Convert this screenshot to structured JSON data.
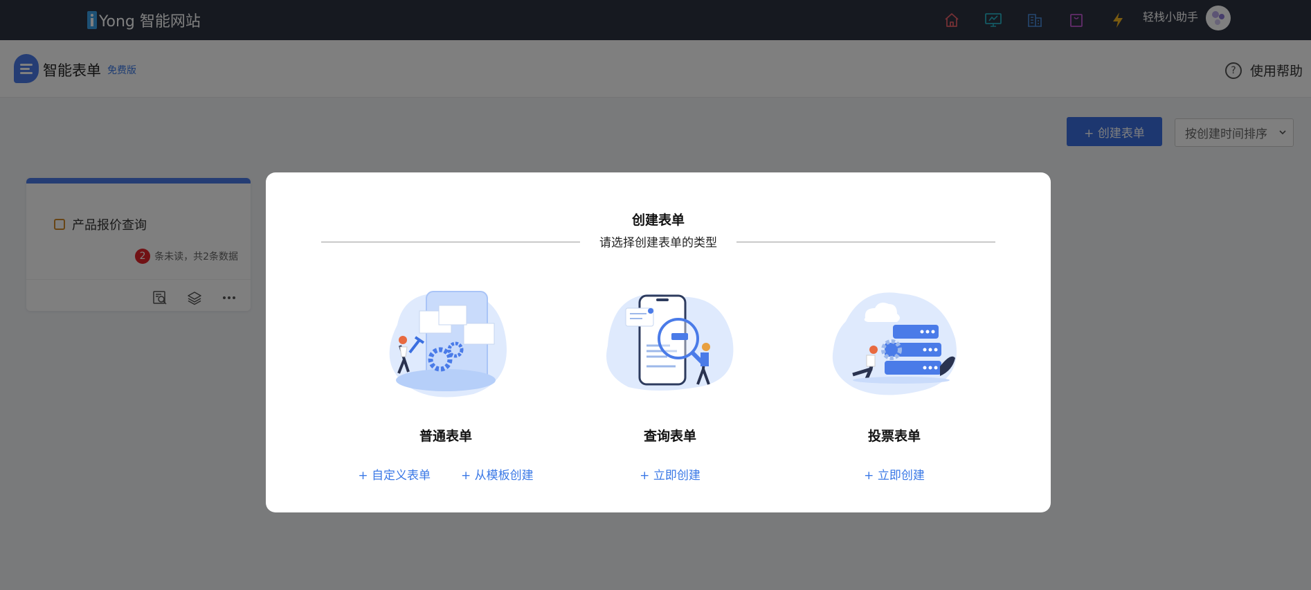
{
  "topbar": {
    "logo_text": "Yong 智能网站",
    "assistant_label": "轻栈小助手",
    "icons": [
      "home-icon",
      "monitor-icon",
      "building-icon",
      "bag-icon",
      "lightning-icon"
    ]
  },
  "header": {
    "app_title": "智能表单",
    "edition_badge": "免费版",
    "help_label": "使用帮助",
    "help_icon_glyph": "?"
  },
  "toolbar": {
    "create_button": "+ 创建表单",
    "sort_select": "按创建时间排序"
  },
  "form_card": {
    "title": "产品报价查询",
    "unread_count": "2",
    "stat_text": "条未读，共2条数据"
  },
  "modal": {
    "title": "创建表单",
    "subtitle": "请选择创建表单的类型",
    "options": [
      {
        "name": "普通表单",
        "links": [
          "+ 自定义表单",
          "+ 从模板创建"
        ]
      },
      {
        "name": "查询表单",
        "links": [
          "+ 立即创建"
        ]
      },
      {
        "name": "投票表单",
        "links": [
          "+ 立即创建"
        ]
      }
    ]
  },
  "colors": {
    "topbar_bg": "#2d3240",
    "accent": "#3b6fe0",
    "link": "#3a78e6",
    "unread_badge": "#e3242b"
  }
}
